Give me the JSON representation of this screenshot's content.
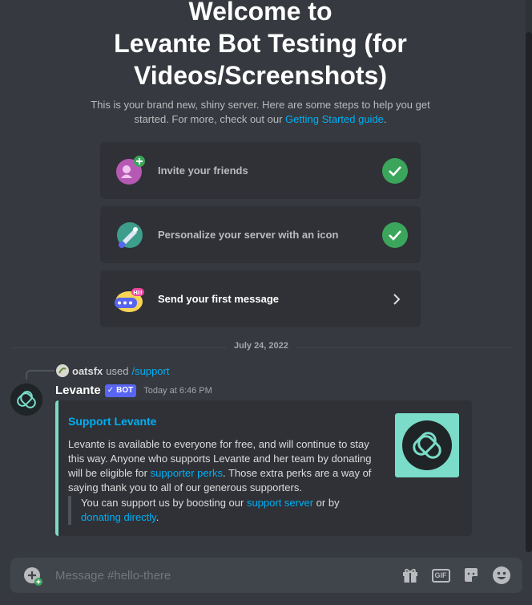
{
  "welcome": {
    "title_lines": [
      "Welcome to",
      "Levante Bot Testing (for",
      "Videos/Screenshots)"
    ],
    "subtitle": "This is your brand new, shiny server. Here are some steps to help you get started. For more, check out our",
    "guide_link": "Getting Started guide",
    "subtitle_end": "."
  },
  "steps": [
    {
      "label": "Invite your friends",
      "status": "done",
      "icon": "invite-friends-icon"
    },
    {
      "label": "Personalize your server with an icon",
      "status": "done",
      "icon": "personalize-icon"
    },
    {
      "label": "Send your first message",
      "status": "todo",
      "icon": "first-message-icon"
    }
  ],
  "chat": {
    "date_divider": "July 24, 2022",
    "reply": {
      "user": "oatsfx",
      "used": "used",
      "command": "/support"
    },
    "message": {
      "author": "Levante",
      "bot_tag": "BOT",
      "timestamp": "Today at 6:46 PM",
      "embed": {
        "color": "#7adcc9",
        "title": "Support Levante",
        "desc_1": "Levante is available to everyone for free, and will continue to stay this way. Anyone who supports Levante and her team by donating will be eligible for",
        "desc_link": "supporter perks",
        "desc_2": ". Those extra perks are a way of saying thank you to all of our generous supporters.",
        "quote_1": "You can support us by boosting our",
        "quote_link_1": "support server",
        "quote_2": "or by",
        "quote_link_2": "donating directly",
        "quote_end": "."
      }
    }
  },
  "composer": {
    "placeholder": "Message #hello-there",
    "gif_label": "GIF"
  },
  "colors": {
    "background": "#36393f",
    "card": "#2f3136",
    "link": "#00aff4",
    "check": "#3ba55c",
    "blurple": "#5865f2",
    "embed_accent": "#7adcc9"
  }
}
